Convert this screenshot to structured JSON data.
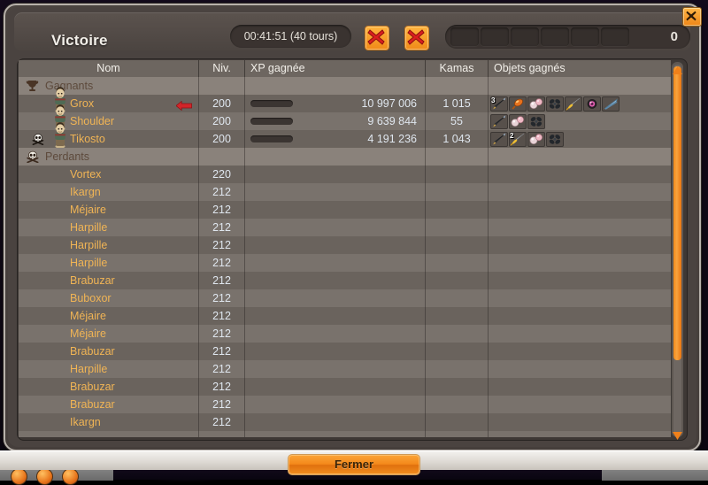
{
  "window": {
    "title": "Victoire",
    "close_label": "x",
    "close_icon": "close-icon"
  },
  "header": {
    "timer": "00:41:51 (40 tours)",
    "kill_badges": [
      "red-cross-icon",
      "red-cross-icon"
    ],
    "empty_slots": 6,
    "slot_count": "0"
  },
  "table": {
    "columns": [
      {
        "key": "name",
        "label": "Nom"
      },
      {
        "key": "level",
        "label": "Niv."
      },
      {
        "key": "xp",
        "label": "XP gagnée"
      },
      {
        "key": "kamas",
        "label": "Kamas"
      },
      {
        "key": "items",
        "label": "Objets gagnés"
      }
    ],
    "groups": [
      {
        "id": "gagnants",
        "label": "Gagnants",
        "icon": "trophy-icon"
      },
      {
        "id": "perdants",
        "label": "Perdants",
        "icon": "skull-crossbones-icon"
      }
    ],
    "winners": [
      {
        "name": "Grox",
        "level": "200",
        "xp": "10 997 006",
        "kamas": "1 015",
        "has_avatar": true,
        "avatar": "character-avatar",
        "marker": "red-left-arrow-icon",
        "items": [
          {
            "glyph": "dagger-icon",
            "qty": "3"
          },
          {
            "glyph": "orange-gem-icon",
            "qty": ""
          },
          {
            "glyph": "pink-pearls-icon",
            "qty": ""
          },
          {
            "glyph": "dark-clover-icon",
            "qty": ""
          },
          {
            "glyph": "yellow-feather-icon",
            "qty": ""
          },
          {
            "glyph": "pink-eye-icon",
            "qty": ""
          },
          {
            "glyph": "blue-blade-icon",
            "qty": ""
          }
        ]
      },
      {
        "name": "Shoulder",
        "level": "200",
        "xp": "9 639 844",
        "kamas": "55",
        "has_avatar": true,
        "avatar": "character-avatar",
        "marker": "",
        "items": [
          {
            "glyph": "dagger-icon",
            "qty": ""
          },
          {
            "glyph": "pink-pearls-icon",
            "qty": ""
          },
          {
            "glyph": "dark-clover-icon",
            "qty": ""
          }
        ]
      },
      {
        "name": "Tikosto",
        "level": "200",
        "xp": "4 191 236",
        "kamas": "1 043",
        "has_avatar": true,
        "avatar": "character-avatar",
        "marker": "skull-icon",
        "items": [
          {
            "glyph": "dagger-icon",
            "qty": ""
          },
          {
            "glyph": "yellow-feather-icon",
            "qty": "2"
          },
          {
            "glyph": "pink-pearls-icon",
            "qty": ""
          },
          {
            "glyph": "dark-clover-icon",
            "qty": ""
          }
        ]
      }
    ],
    "losers": [
      {
        "name": "Vortex",
        "level": "220"
      },
      {
        "name": "Ikargn",
        "level": "212"
      },
      {
        "name": "Méjaire",
        "level": "212"
      },
      {
        "name": "Harpille",
        "level": "212"
      },
      {
        "name": "Harpille",
        "level": "212"
      },
      {
        "name": "Harpille",
        "level": "212"
      },
      {
        "name": "Brabuzar",
        "level": "212"
      },
      {
        "name": "Buboxor",
        "level": "212"
      },
      {
        "name": "Méjaire",
        "level": "212"
      },
      {
        "name": "Méjaire",
        "level": "212"
      },
      {
        "name": "Brabuzar",
        "level": "212"
      },
      {
        "name": "Harpille",
        "level": "212"
      },
      {
        "name": "Brabuzar",
        "level": "212"
      },
      {
        "name": "Brabuzar",
        "level": "212"
      },
      {
        "name": "Ikargn",
        "level": "212"
      }
    ]
  },
  "footer": {
    "close_button": "Fermer"
  },
  "scrollbar": {
    "up_icon": "triangle-up-icon",
    "down_icon": "triangle-down-icon"
  },
  "colors": {
    "accent_orange": "#f08a18",
    "name_text": "#f0b455",
    "value_text": "#dfe6ee",
    "group_text": "#5d4a3c",
    "panel_bg": "#4a4340",
    "row_odd": "#6a635d",
    "row_even": "#79726c"
  }
}
